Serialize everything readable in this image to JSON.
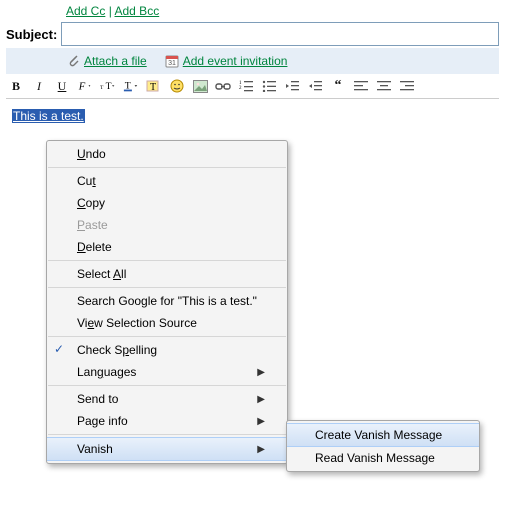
{
  "links": {
    "add_cc": "Add Cc",
    "sep": "|",
    "add_bcc": "Add Bcc"
  },
  "subject_label": "Subject:",
  "subject_value": "",
  "attach": {
    "attach_file": "Attach a file",
    "add_event": "Add event invitation"
  },
  "toolbar": {
    "bold": "B",
    "italic": "I",
    "underline": "U",
    "fontface": "F",
    "fontsize": "tT",
    "fontcolor": "T",
    "highlight": "T"
  },
  "body_text": "This is a test.",
  "ctx": {
    "undo": "Undo",
    "cut": "Cut",
    "copy": "Copy",
    "paste": "Paste",
    "delete": "Delete",
    "select_all": "Select All",
    "search": "Search Google for \"This is a test.\"",
    "view_source": "View Selection Source",
    "check_spelling": "Check Spelling",
    "languages": "Languages",
    "send_to": "Send to",
    "page_info": "Page info",
    "vanish": "Vanish"
  },
  "submenu": {
    "create": "Create Vanish Message",
    "read": "Read Vanish Message"
  }
}
